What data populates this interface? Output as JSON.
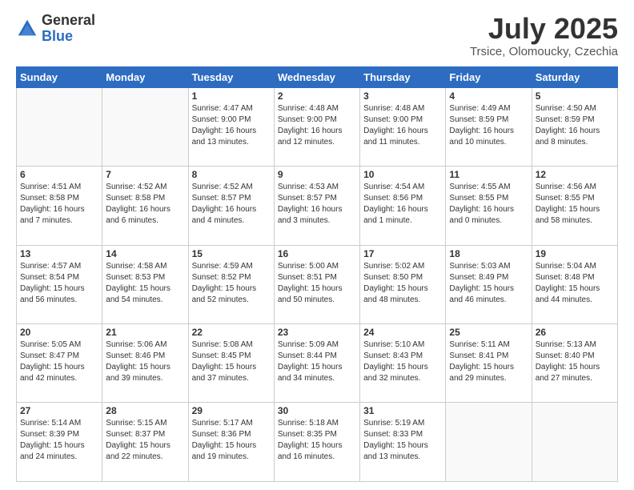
{
  "header": {
    "logo_general": "General",
    "logo_blue": "Blue",
    "month": "July 2025",
    "location": "Trsice, Olomoucky, Czechia"
  },
  "weekdays": [
    "Sunday",
    "Monday",
    "Tuesday",
    "Wednesday",
    "Thursday",
    "Friday",
    "Saturday"
  ],
  "weeks": [
    [
      {
        "day": "",
        "text": ""
      },
      {
        "day": "",
        "text": ""
      },
      {
        "day": "1",
        "text": "Sunrise: 4:47 AM\nSunset: 9:00 PM\nDaylight: 16 hours and 13 minutes."
      },
      {
        "day": "2",
        "text": "Sunrise: 4:48 AM\nSunset: 9:00 PM\nDaylight: 16 hours and 12 minutes."
      },
      {
        "day": "3",
        "text": "Sunrise: 4:48 AM\nSunset: 9:00 PM\nDaylight: 16 hours and 11 minutes."
      },
      {
        "day": "4",
        "text": "Sunrise: 4:49 AM\nSunset: 8:59 PM\nDaylight: 16 hours and 10 minutes."
      },
      {
        "day": "5",
        "text": "Sunrise: 4:50 AM\nSunset: 8:59 PM\nDaylight: 16 hours and 8 minutes."
      }
    ],
    [
      {
        "day": "6",
        "text": "Sunrise: 4:51 AM\nSunset: 8:58 PM\nDaylight: 16 hours and 7 minutes."
      },
      {
        "day": "7",
        "text": "Sunrise: 4:52 AM\nSunset: 8:58 PM\nDaylight: 16 hours and 6 minutes."
      },
      {
        "day": "8",
        "text": "Sunrise: 4:52 AM\nSunset: 8:57 PM\nDaylight: 16 hours and 4 minutes."
      },
      {
        "day": "9",
        "text": "Sunrise: 4:53 AM\nSunset: 8:57 PM\nDaylight: 16 hours and 3 minutes."
      },
      {
        "day": "10",
        "text": "Sunrise: 4:54 AM\nSunset: 8:56 PM\nDaylight: 16 hours and 1 minute."
      },
      {
        "day": "11",
        "text": "Sunrise: 4:55 AM\nSunset: 8:55 PM\nDaylight: 16 hours and 0 minutes."
      },
      {
        "day": "12",
        "text": "Sunrise: 4:56 AM\nSunset: 8:55 PM\nDaylight: 15 hours and 58 minutes."
      }
    ],
    [
      {
        "day": "13",
        "text": "Sunrise: 4:57 AM\nSunset: 8:54 PM\nDaylight: 15 hours and 56 minutes."
      },
      {
        "day": "14",
        "text": "Sunrise: 4:58 AM\nSunset: 8:53 PM\nDaylight: 15 hours and 54 minutes."
      },
      {
        "day": "15",
        "text": "Sunrise: 4:59 AM\nSunset: 8:52 PM\nDaylight: 15 hours and 52 minutes."
      },
      {
        "day": "16",
        "text": "Sunrise: 5:00 AM\nSunset: 8:51 PM\nDaylight: 15 hours and 50 minutes."
      },
      {
        "day": "17",
        "text": "Sunrise: 5:02 AM\nSunset: 8:50 PM\nDaylight: 15 hours and 48 minutes."
      },
      {
        "day": "18",
        "text": "Sunrise: 5:03 AM\nSunset: 8:49 PM\nDaylight: 15 hours and 46 minutes."
      },
      {
        "day": "19",
        "text": "Sunrise: 5:04 AM\nSunset: 8:48 PM\nDaylight: 15 hours and 44 minutes."
      }
    ],
    [
      {
        "day": "20",
        "text": "Sunrise: 5:05 AM\nSunset: 8:47 PM\nDaylight: 15 hours and 42 minutes."
      },
      {
        "day": "21",
        "text": "Sunrise: 5:06 AM\nSunset: 8:46 PM\nDaylight: 15 hours and 39 minutes."
      },
      {
        "day": "22",
        "text": "Sunrise: 5:08 AM\nSunset: 8:45 PM\nDaylight: 15 hours and 37 minutes."
      },
      {
        "day": "23",
        "text": "Sunrise: 5:09 AM\nSunset: 8:44 PM\nDaylight: 15 hours and 34 minutes."
      },
      {
        "day": "24",
        "text": "Sunrise: 5:10 AM\nSunset: 8:43 PM\nDaylight: 15 hours and 32 minutes."
      },
      {
        "day": "25",
        "text": "Sunrise: 5:11 AM\nSunset: 8:41 PM\nDaylight: 15 hours and 29 minutes."
      },
      {
        "day": "26",
        "text": "Sunrise: 5:13 AM\nSunset: 8:40 PM\nDaylight: 15 hours and 27 minutes."
      }
    ],
    [
      {
        "day": "27",
        "text": "Sunrise: 5:14 AM\nSunset: 8:39 PM\nDaylight: 15 hours and 24 minutes."
      },
      {
        "day": "28",
        "text": "Sunrise: 5:15 AM\nSunset: 8:37 PM\nDaylight: 15 hours and 22 minutes."
      },
      {
        "day": "29",
        "text": "Sunrise: 5:17 AM\nSunset: 8:36 PM\nDaylight: 15 hours and 19 minutes."
      },
      {
        "day": "30",
        "text": "Sunrise: 5:18 AM\nSunset: 8:35 PM\nDaylight: 15 hours and 16 minutes."
      },
      {
        "day": "31",
        "text": "Sunrise: 5:19 AM\nSunset: 8:33 PM\nDaylight: 15 hours and 13 minutes."
      },
      {
        "day": "",
        "text": ""
      },
      {
        "day": "",
        "text": ""
      }
    ]
  ]
}
